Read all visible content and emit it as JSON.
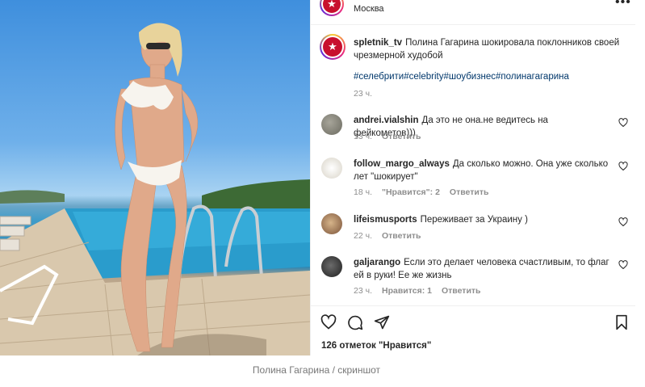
{
  "post_header": {
    "location": "Москва"
  },
  "caption": {
    "username": "spletnik_tv",
    "text": "Полина Гагарина шокировала поклонников своей чрезмерной худобой",
    "hashtags": "#селебрити#celebrity#шоубизнес#полинагагарина",
    "time": "23 ч."
  },
  "comments": [
    {
      "username": "andrei.vialshin",
      "text": "Да это не она.не ведитесь на фейкометов)))",
      "time": "13 ч.",
      "likes": "",
      "reply": "Ответить"
    },
    {
      "username": "follow_margo_always",
      "text": "Да сколько можно. Она уже сколько лет \"шокирует\"",
      "time": "18 ч.",
      "likes": "\"Нравится\": 2",
      "reply": "Ответить"
    },
    {
      "username": "lifeismusports",
      "text": "Переживает за Украину )",
      "time": "22 ч.",
      "likes": "",
      "reply": "Ответить"
    },
    {
      "username": "galjarango",
      "text": "Если это делает человека счастливым, то флаг ей в руки! Ее же жизнь",
      "time": "23 ч.",
      "likes": "Нравится: 1",
      "reply": "Ответить"
    }
  ],
  "likes_count": "126 отметок \"Нравится\"",
  "credit": "Полина Гагарина / скриншот",
  "icons": [
    "heart-icon",
    "comment-icon",
    "share-icon",
    "bookmark-icon",
    "more-icon"
  ],
  "colors": {
    "hashtag": "#00376b",
    "meta": "#8e8e8e",
    "text": "#262626"
  }
}
